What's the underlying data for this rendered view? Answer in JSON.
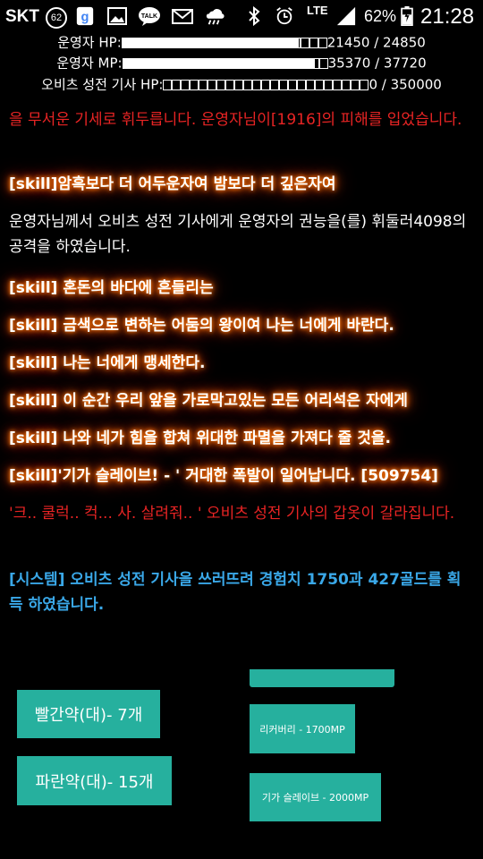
{
  "status_bar": {
    "carrier": "SKT",
    "notification_count": "62",
    "network": "LTE",
    "battery": "62%",
    "time": "21:28",
    "icons": [
      "google-icon",
      "image-icon",
      "talk-icon",
      "mail-icon",
      "weather-icon",
      "bluetooth-icon",
      "alarm-icon",
      "signal-icon",
      "battery-icon"
    ]
  },
  "stats": {
    "hp": {
      "label": "운영자 HP:",
      "value": "21450 / 24850",
      "fraction": 0.863
    },
    "mp": {
      "label": "운영자 MP:",
      "value": "35370 / 37720",
      "fraction": 0.938
    },
    "enemy": {
      "label": "오비츠 성전 기사 HP:",
      "value": "0 / 350000",
      "fraction": 0
    }
  },
  "log": [
    {
      "style": "red",
      "text": "을 무서운 기세로 휘두릅니다. 운영자님이[1916]의 피해를 입었습니다."
    },
    {
      "style": "skill",
      "text": "[skill]암흑보다 더 어두운자여 밤보다 더 깊은자여"
    },
    {
      "style": "white",
      "text": "운영자님께서 오비츠 성전 기사에게 운영자의 권능을(를) 휘둘러4098의 공격을 하였습니다."
    },
    {
      "style": "skill",
      "text": "[skill] 혼돈의 바다에 흔들리는"
    },
    {
      "style": "skill",
      "text": "[skill] 금색으로 변하는 어둠의 왕이여 나는 너에게 바란다."
    },
    {
      "style": "skill",
      "text": "[skill] 나는 너에게 맹세한다."
    },
    {
      "style": "skill",
      "text": "[skill] 이 순간 우리 앞을 가로막고있는 모든 어리석은 자에게"
    },
    {
      "style": "skill",
      "text": "[skill] 나와 네가 힘을 합쳐 위대한 파멸을 가져다 줄 것을."
    },
    {
      "style": "skill",
      "text": "[skill]'기가 슬레이브! - ' 거대한 폭발이 일어납니다. [509754]"
    },
    {
      "style": "red",
      "text": "'크.. 쿨럭.. 컥... 사. 살려줘.. ' 오비츠 성전 기사의 갑옷이 갈라집니다."
    },
    {
      "style": "blue",
      "text": "[시스템] 오비츠 성전 기사을 쓰러뜨려 경험치 1750과 427골드를 획득 하였습니다."
    }
  ],
  "items": {
    "red_potion": "빨간약(대)- 7개",
    "blue_potion": "파란약(대)- 15개"
  },
  "skills": {
    "recovery": "리커버리 - 1700MP",
    "giga_slave": "기가 슬레이브 - 2000MP"
  },
  "colors": {
    "button": "#26b09e",
    "red_text": "#e82424",
    "system_text": "#3aa8e8",
    "glow": "#ff6a00"
  }
}
